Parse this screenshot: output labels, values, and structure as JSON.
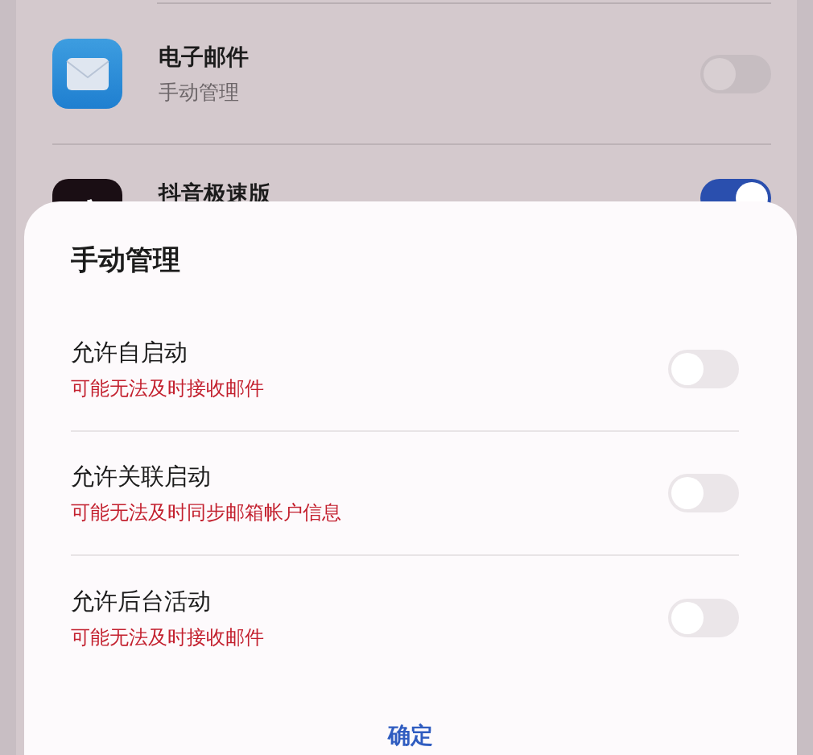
{
  "apps": [
    {
      "name": "电子邮件",
      "status": "手动管理",
      "on": false,
      "kind": "mail"
    },
    {
      "name": "抖音极速版",
      "on": true,
      "kind": "video"
    }
  ],
  "sheet": {
    "title": "手动管理",
    "options": [
      {
        "label": "允许自启动",
        "warning": "可能无法及时接收邮件",
        "on": false
      },
      {
        "label": "允许关联启动",
        "warning": "可能无法及时同步邮箱帐户信息",
        "on": false
      },
      {
        "label": "允许后台活动",
        "warning": "可能无法及时接收邮件",
        "on": false
      }
    ],
    "confirm": "确定"
  }
}
